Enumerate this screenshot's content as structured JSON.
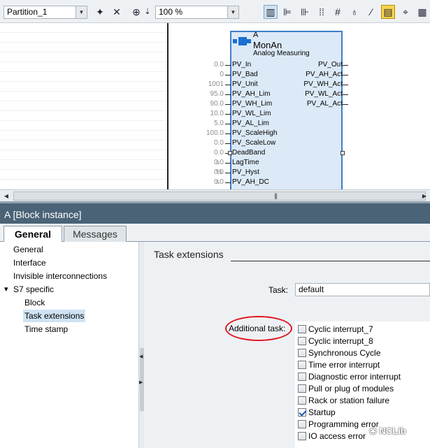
{
  "toolbar": {
    "partition_select": "Partition_1",
    "zoom_select": "100 %",
    "icons": [
      "insert-icon",
      "delete-icon",
      "zoom-icon",
      "fit-icon",
      "layout-icon",
      "pin-icon",
      "grid-icon",
      "interconnect-icon",
      "signal-icon",
      "highlight-icon",
      "trace-icon",
      "overview-icon"
    ]
  },
  "block": {
    "name": "A",
    "type": "MonAn",
    "description": "Analog Measuring",
    "inputs": [
      {
        "label": "PV_In",
        "value": "0.0",
        "unit": ""
      },
      {
        "label": "PV_Bad",
        "value": "0",
        "unit": ""
      },
      {
        "label": "PV_Unit",
        "value": "1001",
        "unit": ""
      },
      {
        "label": "PV_AH_Lim",
        "value": "95.0",
        "unit": ""
      },
      {
        "label": "PV_WH_Lim",
        "value": "90.0",
        "unit": ""
      },
      {
        "label": "PV_WL_Lim",
        "value": "10.0",
        "unit": ""
      },
      {
        "label": "PV_AL_Lim",
        "value": "5.0",
        "unit": ""
      },
      {
        "label": "PV_ScaleHigh",
        "value": "100.0",
        "unit": ""
      },
      {
        "label": "PV_ScaleLow",
        "value": "0.0",
        "unit": ""
      },
      {
        "label": "DeadBand",
        "value": "0.0",
        "unit": ""
      },
      {
        "label": "LagTime",
        "value": "0.0",
        "unit": "s"
      },
      {
        "label": "PV_Hyst",
        "value": "0.0",
        "unit": "%"
      },
      {
        "label": "PV_AH_DC",
        "value": "0.0",
        "unit": "s"
      }
    ],
    "outputs": [
      "PV_Out",
      "PV_AH_Act",
      "PV_WH_Act",
      "PV_WL_Act",
      "PV_AL_Act"
    ]
  },
  "inspector": {
    "title": "A [Block instance]",
    "tabs": [
      "General",
      "Messages"
    ],
    "nav": [
      {
        "label": "General"
      },
      {
        "label": "Interface"
      },
      {
        "label": "Invisible interconnections"
      },
      {
        "label": "S7 specific",
        "expand": "▾"
      },
      {
        "label": "Block"
      },
      {
        "label": "Task extensions"
      },
      {
        "label": "Time stamp"
      }
    ],
    "section_heading": "Task extensions",
    "task_label": "Task:",
    "task_value": "default",
    "additional_task_label": "Additional task:",
    "additional_tasks": [
      {
        "label": "Cyclic interrupt_7",
        "checked": false
      },
      {
        "label": "Cyclic interrupt_8",
        "checked": false
      },
      {
        "label": "Synchronous Cycle",
        "checked": false
      },
      {
        "label": "Time error interrupt",
        "checked": false
      },
      {
        "label": "Diagnostic error interrupt",
        "checked": false
      },
      {
        "label": "Pull or plug of modules",
        "checked": false
      },
      {
        "label": "Rack or station failure",
        "checked": false
      },
      {
        "label": "Startup",
        "checked": true
      },
      {
        "label": "Programming error",
        "checked": false
      },
      {
        "label": "IO access error",
        "checked": false
      }
    ]
  },
  "watermark": "NCLib"
}
